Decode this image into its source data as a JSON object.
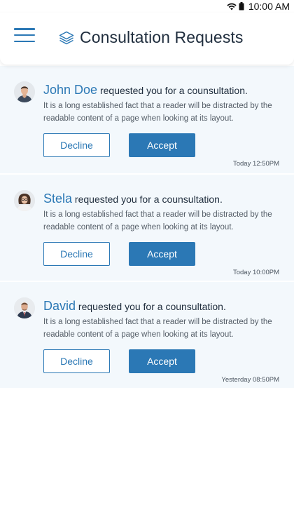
{
  "status": {
    "time": "10:00 AM"
  },
  "header": {
    "title": "Consultation Requests"
  },
  "requests": [
    {
      "name": "John Doe",
      "message": "requested you for a counsultation.",
      "description": "It is a long established fact that a reader will be distracted by the readable content of a page when looking at its layout.",
      "decline_label": "Decline",
      "accept_label": "Accept",
      "time": "Today 12:50PM"
    },
    {
      "name": "Stela",
      "message": "requested you for a counsultation.",
      "description": "It is a long established fact that a reader will be distracted by the readable content of a page when looking at its layout.",
      "decline_label": "Decline",
      "accept_label": "Accept",
      "time": "Today 10:00PM"
    },
    {
      "name": "David",
      "message": "requested you for a counsultation.",
      "description": "It is a long established fact that a reader will be distracted by the readable content of a page when looking at its layout.",
      "decline_label": "Decline",
      "accept_label": "Accept",
      "time": "Yesterday 08:50PM"
    }
  ],
  "icons": {
    "menu": "hamburger-menu-icon",
    "title": "layers-icon",
    "wifi": "wifi-icon",
    "battery": "battery-icon"
  },
  "colors": {
    "accent": "#2b78b5",
    "card_background": "#f3f8fc",
    "title_text": "#1f2d3d"
  }
}
